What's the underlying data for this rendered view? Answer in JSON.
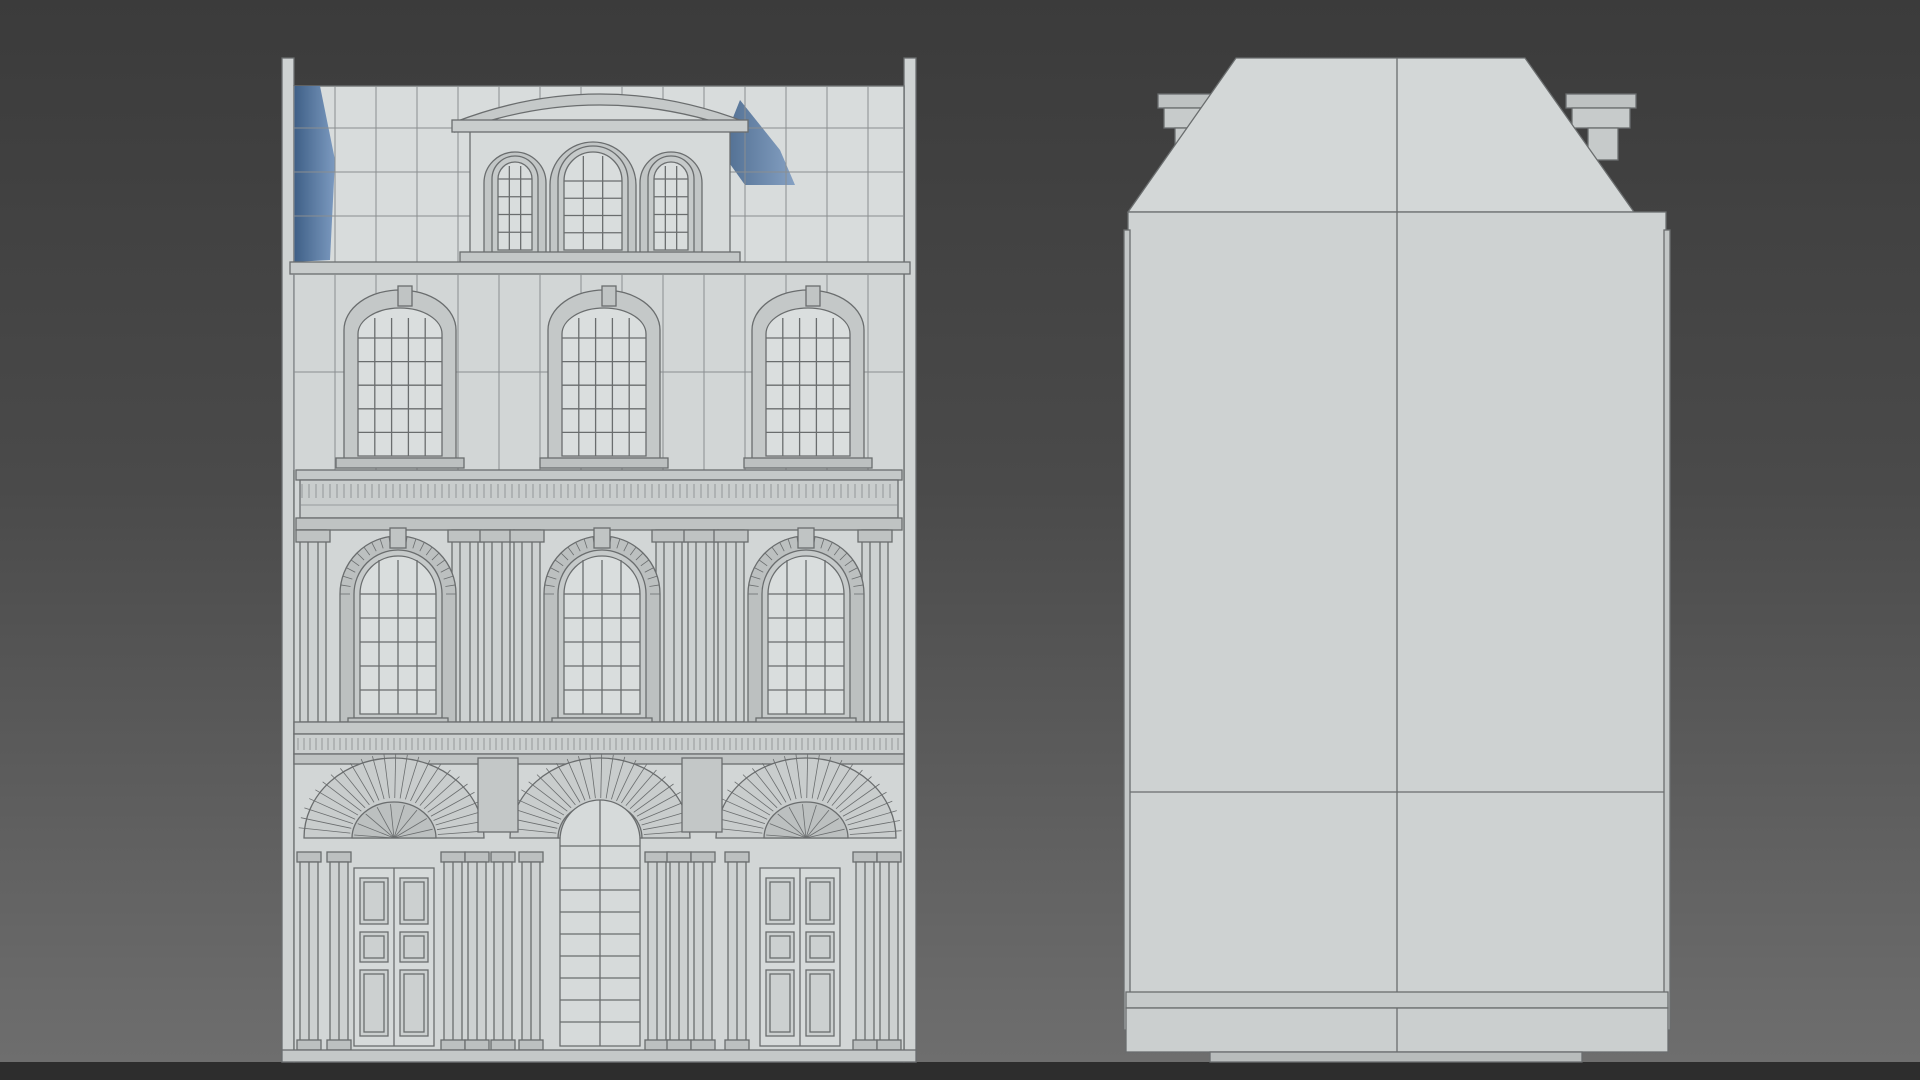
{
  "scene": {
    "views": [
      {
        "id": "front-elevation"
      },
      {
        "id": "side-elevation"
      }
    ],
    "colors": {
      "background_top": "#3c3c3c",
      "background_bottom": "#6e6e6e",
      "wall": "#cfd3d3",
      "wall_light": "#dfe3e3",
      "line": "#6a6d6e",
      "shadow": "#4f6c8c",
      "ground": "#2e2e2e"
    }
  }
}
